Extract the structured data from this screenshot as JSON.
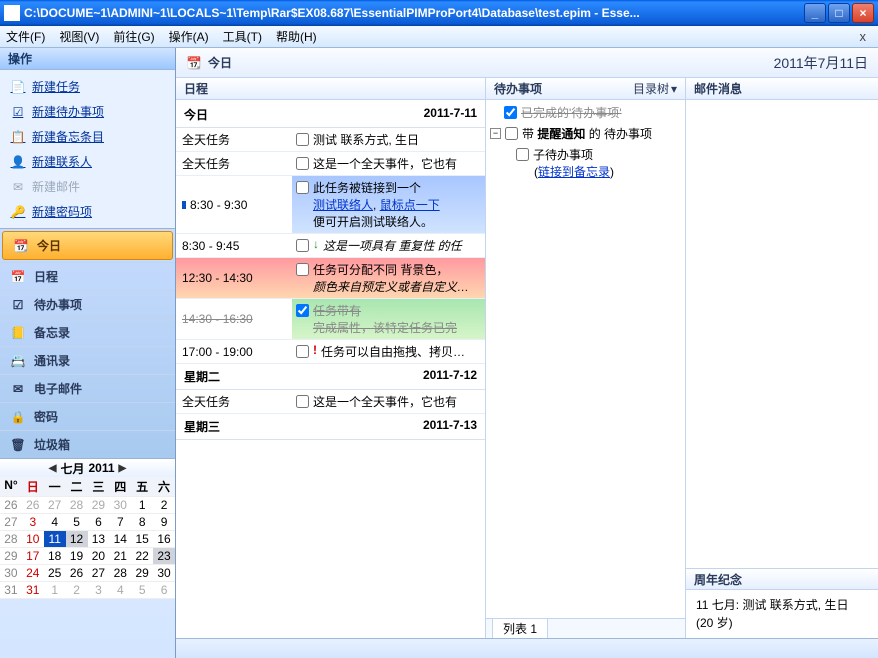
{
  "window": {
    "title": "C:\\DOCUME~1\\ADMINI~1\\LOCALS~1\\Temp\\Rar$EX08.687\\EssentialPIMProPort4\\Database\\test.epim - Esse..."
  },
  "menu": {
    "file": "文件(F)",
    "view": "视图(V)",
    "go": "前往(G)",
    "operate": "操作(A)",
    "tools": "工具(T)",
    "help": "帮助(H)"
  },
  "ops": {
    "title": "操作",
    "new_task": "新建任务",
    "new_todo": "新建待办事项",
    "new_note": "新建备忘条目",
    "new_contact": "新建联系人",
    "new_mail": "新建邮件",
    "new_password": "新建密码项"
  },
  "nav": {
    "today": "今日",
    "schedule": "日程",
    "todo": "待办事项",
    "notes": "备忘录",
    "contacts": "通讯录",
    "email": "电子邮件",
    "password": "密码",
    "trash": "垃圾箱"
  },
  "calendar": {
    "month": "七月",
    "year": "2011",
    "header": [
      "N°",
      "日",
      "一",
      "二",
      "三",
      "四",
      "五",
      "六"
    ],
    "weeks": [
      {
        "no": "26",
        "days": [
          "26",
          "27",
          "28",
          "29",
          "30",
          "1",
          "2"
        ],
        "out": [
          0,
          1,
          2,
          3,
          4
        ]
      },
      {
        "no": "27",
        "days": [
          "3",
          "4",
          "5",
          "6",
          "7",
          "8",
          "9"
        ]
      },
      {
        "no": "28",
        "days": [
          "10",
          "11",
          "12",
          "13",
          "14",
          "15",
          "16"
        ],
        "today": 1,
        "tom": 2
      },
      {
        "no": "29",
        "days": [
          "17",
          "18",
          "19",
          "20",
          "21",
          "22",
          "23"
        ],
        "hl": 6
      },
      {
        "no": "30",
        "days": [
          "24",
          "25",
          "26",
          "27",
          "28",
          "29",
          "30"
        ]
      },
      {
        "no": "31",
        "days": [
          "31",
          "1",
          "2",
          "3",
          "4",
          "5",
          "6"
        ],
        "out": [
          1,
          2,
          3,
          4,
          5,
          6
        ]
      }
    ]
  },
  "main": {
    "title": "今日",
    "date": "2011年7月11日"
  },
  "schedule": {
    "head": "日程",
    "today_label": "今日",
    "today_date": "2011-7-11",
    "all_day": "全天任务",
    "r1_desc": "测试 联系方式, 生日",
    "r2_desc": "这是一个全天事件，它也有",
    "r3_time": "8:30 - 9:30",
    "r3_l1": "此任务被链接到一个",
    "r3_link1": "测试联络人",
    "r3_link2": "鼠标点一下",
    "r3_l3": "便可开启测试联络人。",
    "r4_time": "8:30 - 9:45",
    "r4_desc": "这是一项具有 重复性 的任",
    "r5_time": "12:30 - 14:30",
    "r5_l1": "任务可分配不同 背景色，",
    "r5_l2": "颜色来自预定义或者自定义…",
    "r6_time": "14:30 - 16:30",
    "r6_l1": "任务带有",
    "r6_l2": "完成属性，该特定任务已完",
    "r7_time": "17:00 - 19:00",
    "r7_desc": "任务可以自由拖拽、拷贝…",
    "tue_label": "星期二",
    "tue_date": "2011-7-12",
    "tue_desc": "这是一个全天事件，它也有",
    "wed_label": "星期三",
    "wed_date": "2011-7-13"
  },
  "todo": {
    "head": "待办事项",
    "view": "目录树",
    "done": "已完成的'待办事项'",
    "reminder_pre": "带 ",
    "reminder_bold": "提醒通知",
    "reminder_post": " 的 待办事项",
    "child": "子待办事项",
    "link_text": "链接到备忘录",
    "bottom_tab": "列表 1"
  },
  "mail": {
    "head": "邮件消息"
  },
  "anniv": {
    "head": "周年纪念",
    "line1": "11 七月: 测试 联系方式, 生日 (20 岁)"
  }
}
